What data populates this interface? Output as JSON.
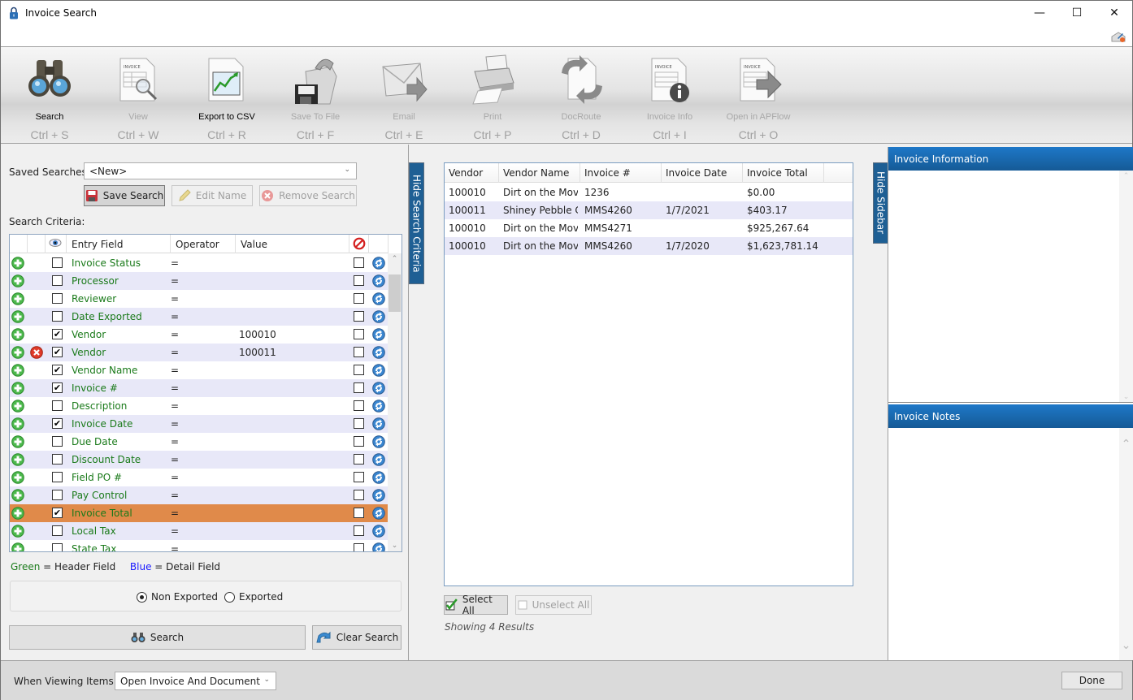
{
  "window": {
    "title": "Invoice Search",
    "controls": {
      "minimize": "—",
      "maximize": "☐",
      "close": "✕"
    }
  },
  "toolbar": {
    "buttons": [
      {
        "label": "Search",
        "shortcut": "Ctrl + S",
        "icon": "binoculars-icon",
        "enabled": true
      },
      {
        "label": "View",
        "shortcut": "Ctrl + W",
        "icon": "invoice-magnifier-icon",
        "enabled": false
      },
      {
        "label": "Export to CSV",
        "shortcut": "Ctrl + R",
        "icon": "chart-document-icon",
        "enabled": true
      },
      {
        "label": "Save To File",
        "shortcut": "Ctrl + F",
        "icon": "save-folder-icon",
        "enabled": false
      },
      {
        "label": "Email",
        "shortcut": "Ctrl + E",
        "icon": "email-icon",
        "enabled": false
      },
      {
        "label": "Print",
        "shortcut": "Ctrl + P",
        "icon": "printer-icon",
        "enabled": false
      },
      {
        "label": "DocRoute",
        "shortcut": "Ctrl + D",
        "icon": "docroute-icon",
        "enabled": false
      },
      {
        "label": "Invoice Info",
        "shortcut": "Ctrl + I",
        "icon": "invoice-info-icon",
        "enabled": false
      },
      {
        "label": "Open in APFlow",
        "shortcut": "Ctrl + O",
        "icon": "invoice-open-icon",
        "enabled": false
      }
    ]
  },
  "saved_searches": {
    "label": "Saved Searches:",
    "value": "<New>",
    "save_label": "Save Search",
    "edit_label": "Edit Name",
    "remove_label": "Remove Search"
  },
  "criteria": {
    "label": "Search Criteria:",
    "headers": {
      "entry_field": "Entry Field",
      "operator": "Operator",
      "value": "Value"
    },
    "rows": [
      {
        "field": "Invoice Status",
        "operator": "=",
        "value": "",
        "visible": false,
        "deletable": false
      },
      {
        "field": "Processor",
        "operator": "=",
        "value": "",
        "visible": false,
        "deletable": false
      },
      {
        "field": "Reviewer",
        "operator": "=",
        "value": "",
        "visible": false,
        "deletable": false
      },
      {
        "field": "Date Exported",
        "operator": "=",
        "value": "",
        "visible": false,
        "deletable": false
      },
      {
        "field": "Vendor",
        "operator": "=",
        "value": "100010",
        "visible": true,
        "deletable": false
      },
      {
        "field": "Vendor",
        "operator": "=",
        "value": "100011",
        "visible": true,
        "deletable": true
      },
      {
        "field": "Vendor Name",
        "operator": "=",
        "value": "",
        "visible": true,
        "deletable": false
      },
      {
        "field": "Invoice #",
        "operator": "=",
        "value": "",
        "visible": true,
        "deletable": false
      },
      {
        "field": "Description",
        "operator": "=",
        "value": "",
        "visible": false,
        "deletable": false
      },
      {
        "field": "Invoice Date",
        "operator": "=",
        "value": "",
        "visible": true,
        "deletable": false
      },
      {
        "field": "Due Date",
        "operator": "=",
        "value": "",
        "visible": false,
        "deletable": false
      },
      {
        "field": "Discount Date",
        "operator": "=",
        "value": "",
        "visible": false,
        "deletable": false
      },
      {
        "field": "Field PO #",
        "operator": "=",
        "value": "",
        "visible": false,
        "deletable": false
      },
      {
        "field": "Pay Control",
        "operator": "=",
        "value": "",
        "visible": false,
        "deletable": false
      },
      {
        "field": "Invoice Total",
        "operator": "=",
        "value": "",
        "visible": true,
        "deletable": false,
        "selected": true
      },
      {
        "field": "Local Tax",
        "operator": "=",
        "value": "",
        "visible": false,
        "deletable": false
      },
      {
        "field": "State Tax",
        "operator": "=",
        "value": "",
        "visible": false,
        "deletable": false
      }
    ]
  },
  "legend": {
    "green_word": "Green",
    "green_desc": "= Header Field",
    "blue_word": "Blue",
    "blue_desc": "= Detail Field",
    "green_color": "#1a7a1a",
    "blue_color": "#1a1aff"
  },
  "export_filter": {
    "options": [
      "Non Exported",
      "Exported"
    ],
    "selected": "Non Exported"
  },
  "actions": {
    "search_label": "Search",
    "clear_label": "Clear Search"
  },
  "tabs": {
    "hide_search_criteria": "Hide Search Criteria",
    "hide_sidebar": "Hide Sidebar"
  },
  "results": {
    "headers": [
      "Vendor",
      "Vendor Name",
      "Invoice #",
      "Invoice Date",
      "Invoice Total"
    ],
    "rows": [
      [
        "100010",
        "Dirt on the Move",
        "1236",
        "",
        "$0.00"
      ],
      [
        "100011",
        "Shiney Pebble Co",
        "MMS4260",
        "1/7/2021",
        "$403.17"
      ],
      [
        "100010",
        "Dirt on the Move",
        "MMS4271",
        "",
        "$925,267.64"
      ],
      [
        "100010",
        "Dirt on the Move",
        "MMS4260",
        "1/7/2020",
        "$1,623,781.14"
      ]
    ],
    "select_all": "Select All",
    "unselect_all": "Unselect All",
    "status": "Showing 4 Results"
  },
  "sidebar": {
    "info_title": "Invoice Information",
    "notes_title": "Invoice Notes",
    "header_color": "#1a6ab4"
  },
  "bottom": {
    "viewing_label": "When Viewing Items:",
    "viewing_value": "Open Invoice And Document",
    "done_label": "Done"
  }
}
